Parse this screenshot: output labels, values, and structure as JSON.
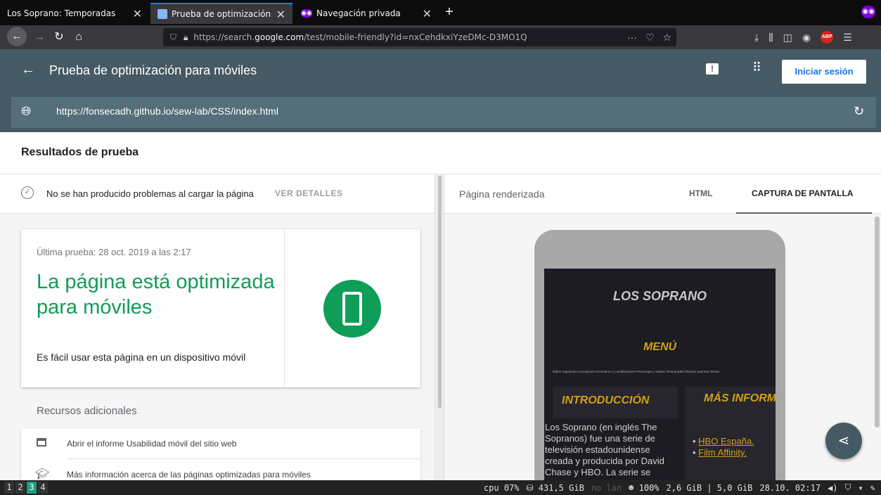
{
  "browser": {
    "tabs": [
      {
        "title": "Los Soprano: Temporadas",
        "active": false
      },
      {
        "title": "Prueba de optimización pa",
        "active": true
      },
      {
        "title": "Navegación privada",
        "active": false
      }
    ],
    "url_prefix": "https://search.",
    "url_domain": "google.com",
    "url_rest": "/test/mobile-friendly?id=nxCehdkxiYzeDMc-D3MO1Q",
    "url_menu": "···",
    "abp": "ABP"
  },
  "header": {
    "title": "Prueba de optimización para móviles",
    "signin": "Iniciar sesión",
    "tested_url": "https://fonsecadh.github.io/sew-lab/CSS/index.html"
  },
  "results_title": "Resultados de prueba",
  "left": {
    "status": "No se han producido problemas al cargar la página",
    "details": "VER DETALLES",
    "last_test": "Última prueba: 28 oct. 2019 a las 2:17",
    "verdict": "La página está optimizada para móviles",
    "verdict_sub": "Es fácil usar esta página en un dispositivo móvil",
    "resources_title": "Recursos adicionales",
    "resources": [
      "Abrir el informe Usabilidad móvil del sitio web",
      "Más información acerca de las páginas optimizadas para móviles"
    ]
  },
  "right": {
    "rendered_label": "Página renderizada",
    "tab_html": "HTML",
    "tab_capture": "CAPTURA DE PANTALLA",
    "screenshot": {
      "title": "LOS SOPRANO",
      "menu": "MENÚ",
      "menu_links": "Índice  Argumento  Concepción  Escenarios y Localizaciones  Personajes y reparto  Temporadas  Premios  Apertura  Temas",
      "intro_heading": "INTRODUCCIÓN",
      "more_heading": "MÁS INFORMACIÓN",
      "intro_text": "Los Soprano (en inglés The Sopranos) fue una serie de televisión estadounidense creada y producida por David Chase y HBO. La serie se",
      "links": [
        "HBO España.",
        "Film Affinity."
      ]
    }
  },
  "statusbar": {
    "workspaces": [
      "1",
      "2",
      "3",
      "4"
    ],
    "active_workspace": "3",
    "cpu": "cpu  07%",
    "disk": "⛁ 431,5 GiB",
    "lan": "no lan",
    "battery": "☻ 100%",
    "mem": "2,6 GiB | 5,0 GiB",
    "datetime": "28.10. 02:17"
  }
}
